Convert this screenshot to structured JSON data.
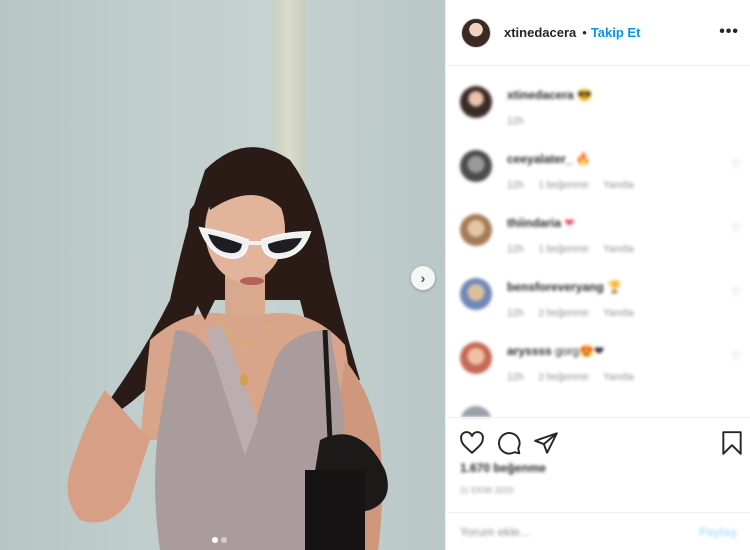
{
  "post": {
    "username": "xtinedacera",
    "separator": "•",
    "follow_label": "Takip Et",
    "more_icon": "more-horizontal-icon",
    "image_alt_icons": [
      "next-arrow-icon"
    ],
    "carousel": {
      "count": 2,
      "active": 0
    }
  },
  "comments": [
    {
      "user": "xtinedacera",
      "text": "😎",
      "time": "12h",
      "likes": "",
      "reply": ""
    },
    {
      "user": "ceeyalater_",
      "text": "🔥",
      "time": "12h",
      "likes": "1 beğenme",
      "reply": "Yanıtla"
    },
    {
      "user": "thiindaria",
      "text": "❤",
      "time": "12h",
      "likes": "1 beğenme",
      "reply": "Yanıtla"
    },
    {
      "user": "bensforeveryang",
      "text": "🏆",
      "time": "12h",
      "likes": "2 beğenme",
      "reply": "Yanıtla"
    },
    {
      "user": "aryssss",
      "text": "gorg😍❤",
      "time": "12h",
      "likes": "2 beğenme",
      "reply": "Yanıtla"
    }
  ],
  "actions": {
    "like_icon": "heart-icon",
    "comment_icon": "comment-icon",
    "share_icon": "share-icon",
    "save_icon": "bookmark-icon",
    "likes_count": "1.670 beğenme",
    "date": "11 EKİM 2020"
  },
  "add_comment": {
    "placeholder": "Yorum ekle...",
    "post_label": "Paylaş"
  },
  "colors": {
    "accent": "#0095f6",
    "post_disabled": "#b2dffc",
    "heart_red": "#ed4956",
    "muted": "#8e8e8e"
  }
}
